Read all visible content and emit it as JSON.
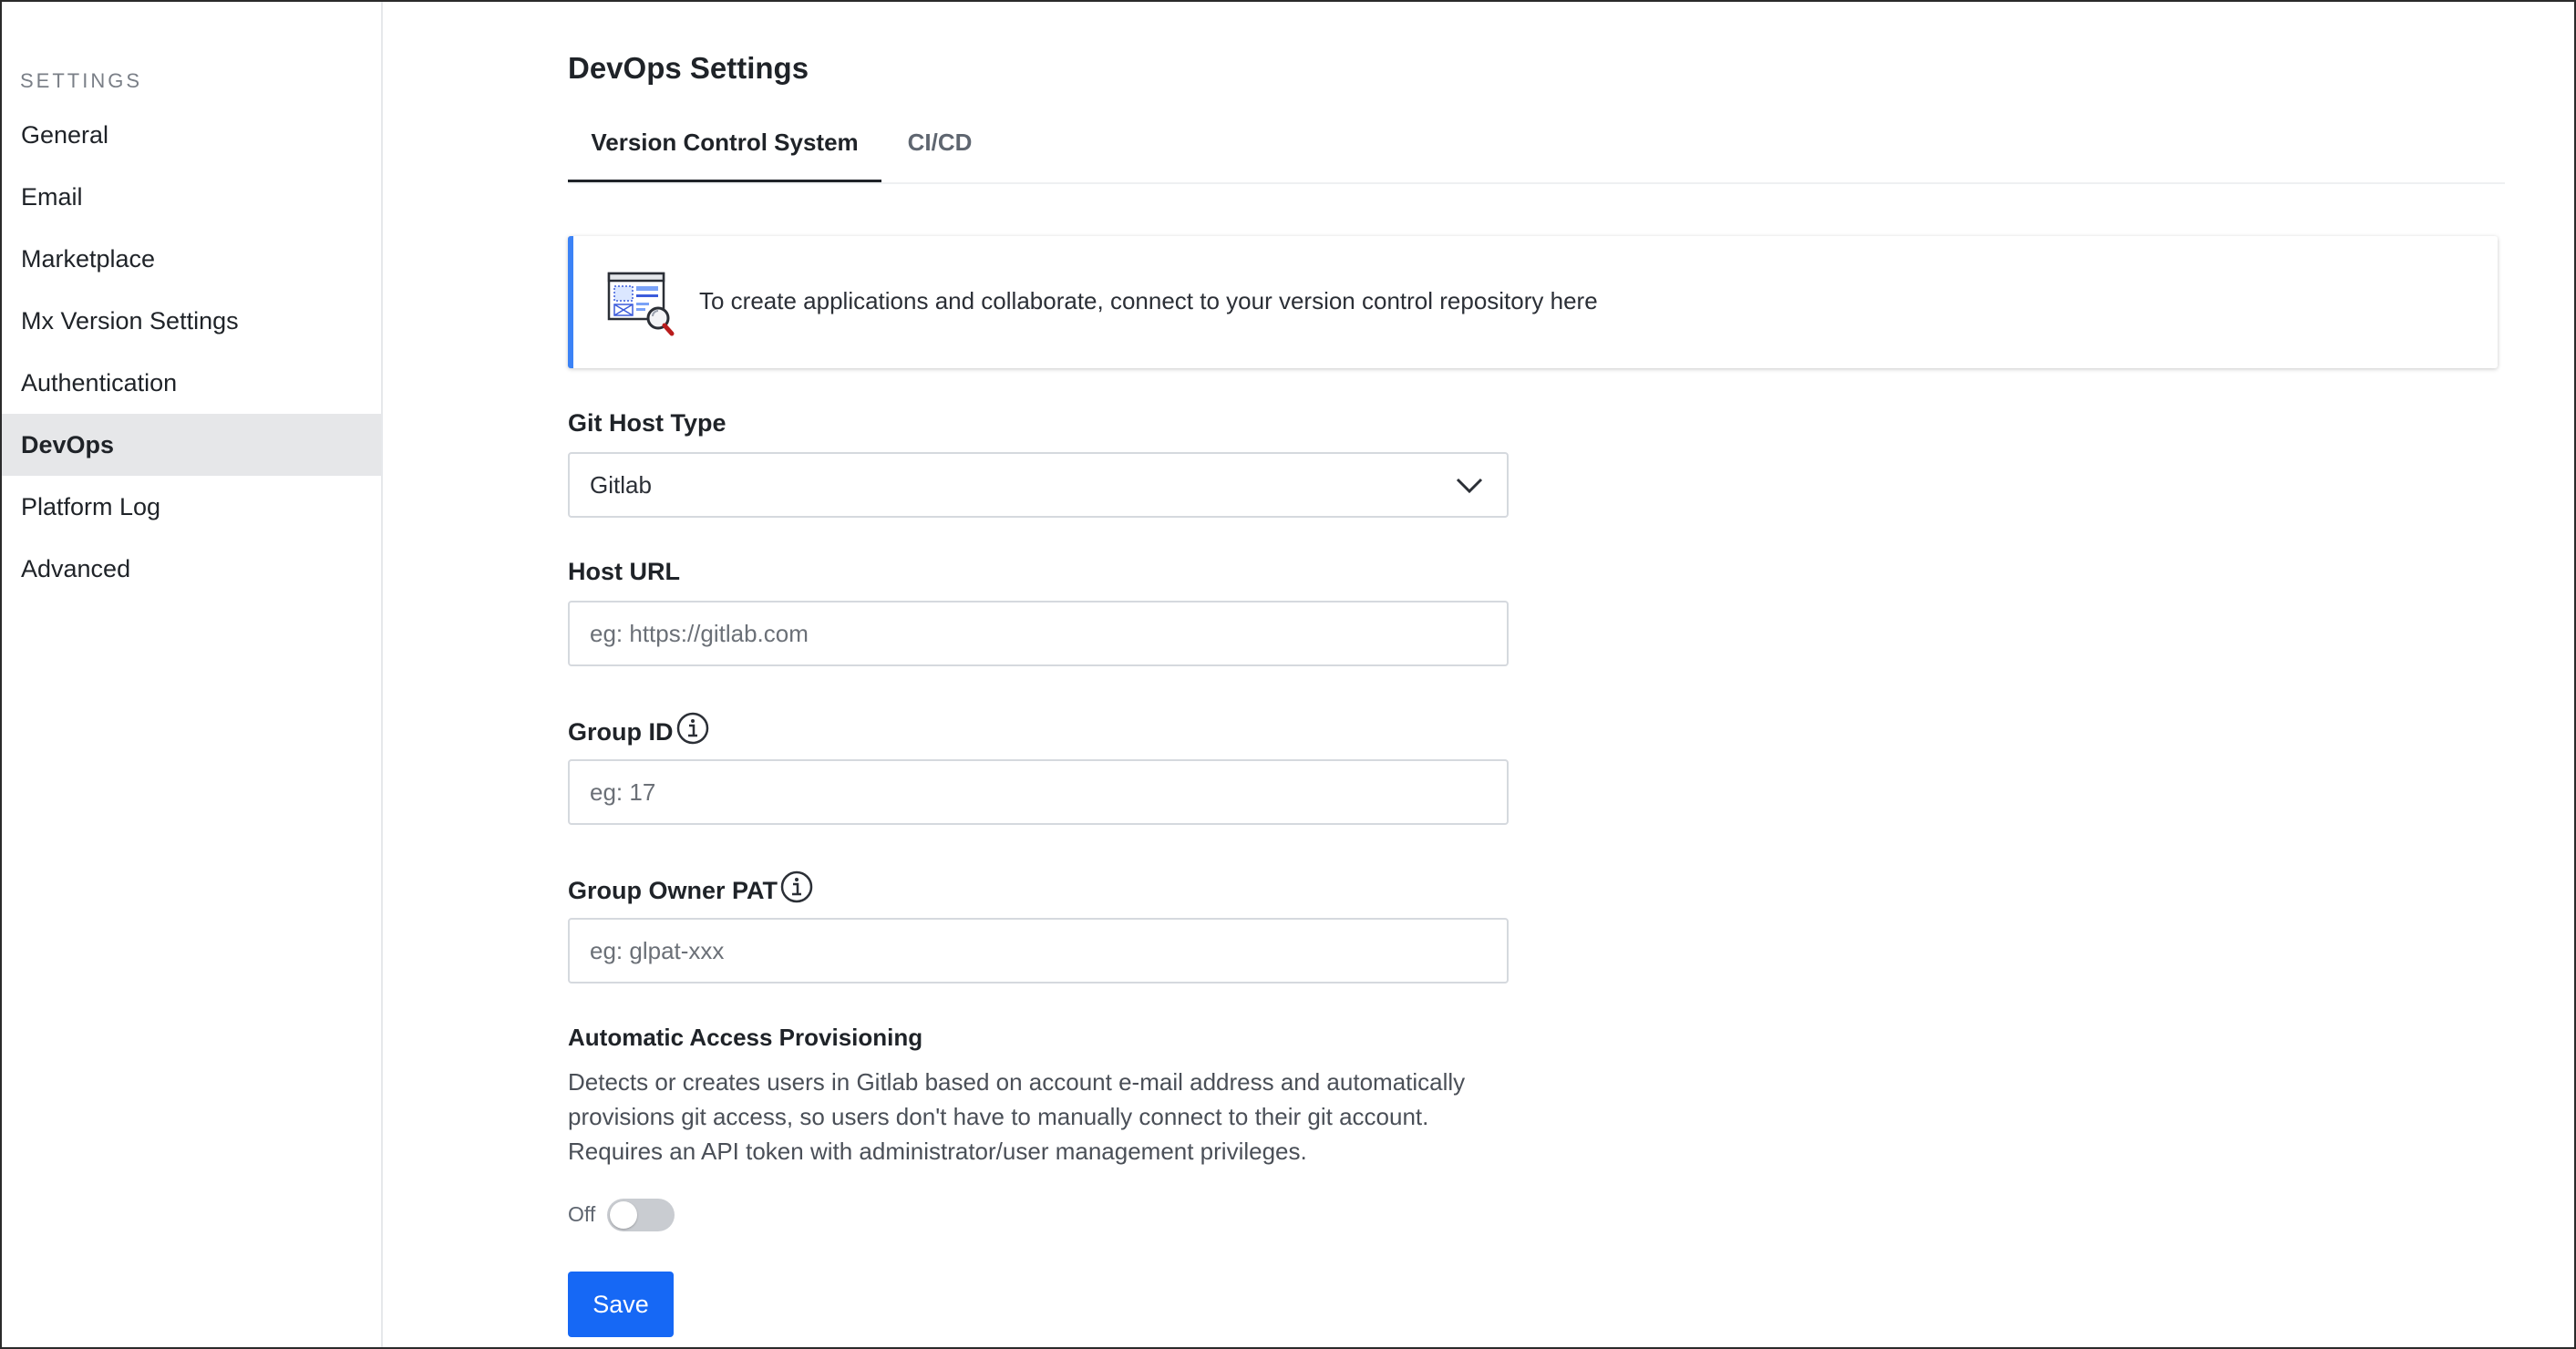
{
  "sidebar": {
    "heading": "SETTINGS",
    "items": [
      {
        "label": "General",
        "active": false
      },
      {
        "label": "Email",
        "active": false
      },
      {
        "label": "Marketplace",
        "active": false
      },
      {
        "label": "Mx Version Settings",
        "active": false
      },
      {
        "label": "Authentication",
        "active": false
      },
      {
        "label": "DevOps",
        "active": true
      },
      {
        "label": "Platform Log",
        "active": false
      },
      {
        "label": "Advanced",
        "active": false
      }
    ]
  },
  "main": {
    "title": "DevOps Settings",
    "tabs": [
      {
        "label": "Version Control System",
        "active": true
      },
      {
        "label": "CI/CD",
        "active": false
      }
    ],
    "banner": {
      "icon": "repository-search-illustration-icon",
      "text": "To create applications and collaborate, connect to your version control repository here",
      "accent_color": "#3b82f6"
    },
    "form": {
      "git_host_type": {
        "label": "Git Host Type",
        "value": "Gitlab",
        "icon": "chevron-down-icon"
      },
      "host_url": {
        "label": "Host URL",
        "placeholder": "eg: https://gitlab.com",
        "value": ""
      },
      "group_id": {
        "label": "Group ID",
        "placeholder": "eg: 17",
        "value": "",
        "icon": "info-icon"
      },
      "group_owner_pat": {
        "label": "Group Owner PAT",
        "placeholder": "eg: glpat-xxx",
        "value": "",
        "icon": "info-icon"
      },
      "auto_provisioning": {
        "label": "Automatic Access Provisioning",
        "description_lines": [
          "Detects or creates users in Gitlab based on account e-mail address and automatically",
          "provisions git access, so users don't have to manually connect to their git account.",
          "Requires an API token with administrator/user management privileges."
        ],
        "toggle_label": "Off",
        "enabled": false
      },
      "save_label": "Save",
      "save_color": "#1668f5"
    }
  }
}
